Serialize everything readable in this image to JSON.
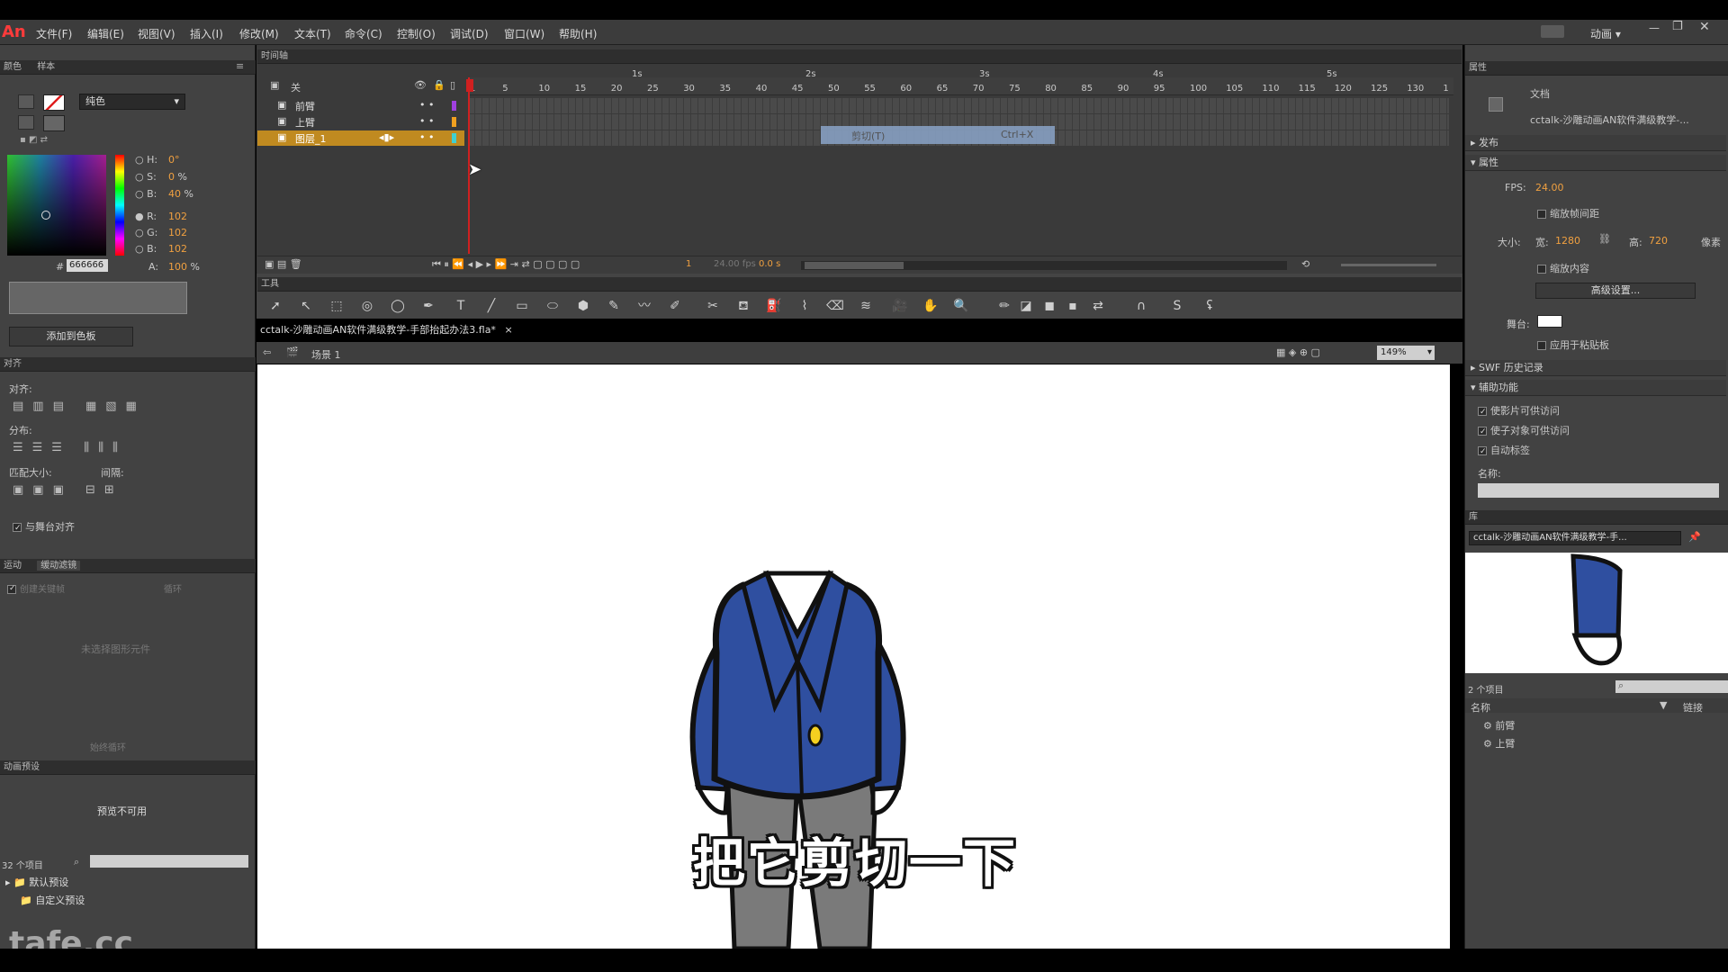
{
  "app": {
    "logo": "An",
    "mode": "动画 ▾"
  },
  "menu": [
    "文件(F)",
    "编辑(E)",
    "视图(V)",
    "插入(I)",
    "修改(M)",
    "文本(T)",
    "命令(C)",
    "控制(O)",
    "调试(D)",
    "窗口(W)",
    "帮助(H)"
  ],
  "color_panel": {
    "tabs": [
      "颜色",
      "样本"
    ],
    "fill_type": "纯色",
    "h": "0",
    "h_unit": "°",
    "s": "0",
    "s_unit": "%",
    "b": "40",
    "b_unit": "%",
    "r": "102",
    "g": "102",
    "bl": "102",
    "a": "100",
    "a_unit": "%",
    "hex": "666666",
    "hex_prefix": "#",
    "labels": {
      "h": "H:",
      "s": "S:",
      "b": "B:",
      "r": "R:",
      "g": "G:",
      "bl": "B:",
      "a": "A:"
    },
    "add_button": "添加到色板",
    "color_hex": "#666666"
  },
  "align_panel": {
    "title": "对齐",
    "align_label": "对齐:",
    "distribute_label": "分布:",
    "match_label": "匹配大小:",
    "spacing_label": "间隔:",
    "stage_align": "与舞台对齐"
  },
  "motion_panel": {
    "tabs": [
      "运动",
      "缓动滤镜"
    ],
    "create_keyframe": "创建关键帧",
    "empty_text": "未选择图形元件",
    "dropdown": "循环",
    "loop": "始终循环"
  },
  "presets_panel": {
    "title": "动画预设",
    "preview": "预览不可用",
    "count": "32 个项目",
    "folders": [
      "默认预设",
      "自定义预设"
    ]
  },
  "timeline": {
    "title": "时间轴",
    "header_col": "关",
    "layers": [
      {
        "name": "前臂",
        "color": "#a040e0"
      },
      {
        "name": "上臂",
        "color": "#f0a020"
      },
      {
        "name": "图层_1",
        "color": "#40d0d0",
        "selected": true
      }
    ],
    "ruler_nums": [
      "1",
      "5",
      "10",
      "15",
      "20",
      "25",
      "30",
      "35",
      "40",
      "45",
      "50",
      "55",
      "60",
      "65",
      "70",
      "75",
      "80",
      "85",
      "90",
      "95",
      "100",
      "105",
      "110",
      "115",
      "120",
      "125",
      "130",
      "1"
    ],
    "seconds": [
      "1s",
      "2s",
      "3s",
      "4s",
      "5s"
    ],
    "context": {
      "cut": "剪切(T)",
      "shortcut": "Ctrl+X"
    },
    "frame": "1",
    "fps": "24.00 fps",
    "time": "0.0 s"
  },
  "tools": {
    "title": "工具"
  },
  "document": {
    "tab": "cctalk-沙雕动画AN软件满级教学-手部抬起办法3.fla*",
    "close": "×",
    "scene": "场景 1",
    "zoom": "149%"
  },
  "stage": {
    "subtitle": "把它剪切一下",
    "watermark": "tafe.cc"
  },
  "properties": {
    "title": "属性",
    "doc_label": "文档",
    "doc_name": "cctalk-沙雕动画AN软件满级教学-...",
    "publish": "发布",
    "props": "属性",
    "fps_label": "FPS:",
    "fps": "24.00",
    "scale_spacing": "缩放帧间距",
    "size_label": "大小:",
    "w_label": "宽:",
    "w": "1280",
    "h_label": "高:",
    "h": "720",
    "unit": "像素",
    "scale_content": "缩放内容",
    "advanced": "高级设置...",
    "stage_label": "舞台:",
    "apply_paste": "应用于粘贴板",
    "swf_history": "SWF 历史记录",
    "accessibility": "辅助功能",
    "acc_items": [
      "使影片可供访问",
      "使子对象可供访问",
      "自动标签"
    ],
    "name_label": "名称:"
  },
  "library": {
    "title": "库",
    "doc_select": "cctalk-沙雕动画AN软件满级教学-手...",
    "count": "2 个项目",
    "col_name": "名称",
    "col_link": "链接",
    "items": [
      "前臂",
      "上臂"
    ]
  }
}
